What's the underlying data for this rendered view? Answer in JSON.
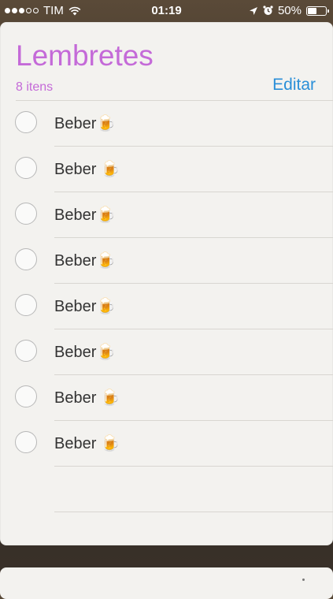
{
  "status_bar": {
    "signal_full": 3,
    "signal_total": 5,
    "carrier": "TIM",
    "time": "01:19",
    "battery_percent": "50%",
    "battery_level": 0.5,
    "icons": [
      "wifi-icon",
      "location-arrow-icon",
      "alarm-icon"
    ]
  },
  "list": {
    "title": "Lembretes",
    "count": "8 itens",
    "edit_label": "Editar",
    "title_color": "#c46ad8",
    "accent_color": "#2a8fd8"
  },
  "items": [
    {
      "label": "Beber🍺"
    },
    {
      "label": "Beber 🍺"
    },
    {
      "label": "Beber🍺"
    },
    {
      "label": "Beber🍺"
    },
    {
      "label": "Beber🍺"
    },
    {
      "label": "Beber🍺"
    },
    {
      "label": "Beber 🍺"
    },
    {
      "label": "Beber 🍺"
    }
  ]
}
